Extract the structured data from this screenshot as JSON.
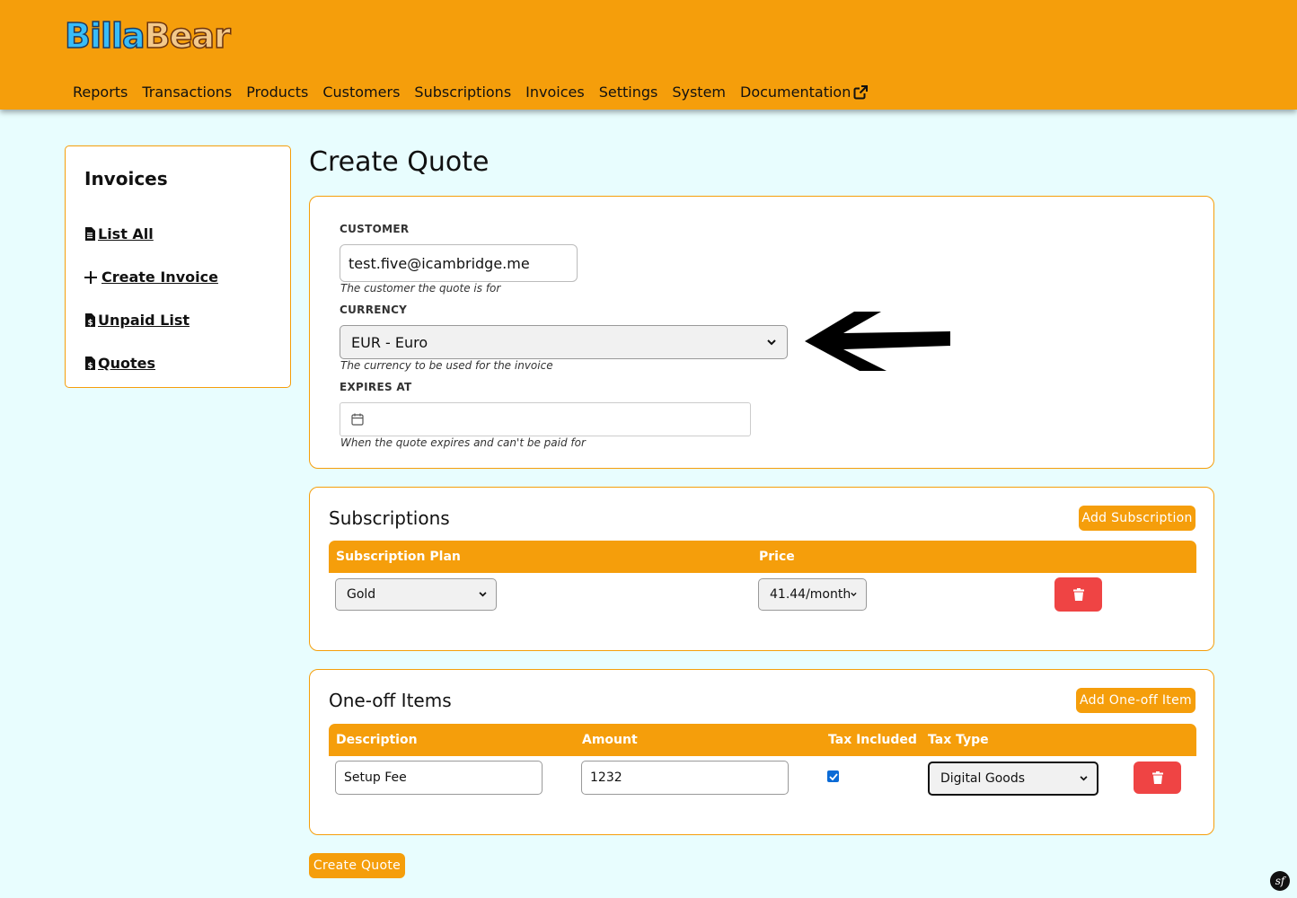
{
  "brand": {
    "part1": "Billa",
    "part2": "Bear"
  },
  "nav": {
    "reports": "Reports",
    "transactions": "Transactions",
    "products": "Products",
    "customers": "Customers",
    "subscriptions": "Subscriptions",
    "invoices": "Invoices",
    "settings": "Settings",
    "system": "System",
    "documentation": "Documentation"
  },
  "sidebar": {
    "title": "Invoices",
    "items": [
      {
        "label": "List All",
        "icon": "file-icon"
      },
      {
        "label": "Create Invoice",
        "icon": "plus-icon"
      },
      {
        "label": "Unpaid List",
        "icon": "file-invoice-dollar-icon"
      },
      {
        "label": "Quotes",
        "icon": "file-invoice-dollar-icon"
      }
    ]
  },
  "page": {
    "title": "Create Quote"
  },
  "form": {
    "customer_label": "CUSTOMER",
    "customer_value": "test.five@icambridge.me",
    "customer_help": "The customer the quote is for",
    "currency_label": "CURRENCY",
    "currency_value": "EUR - Euro",
    "currency_help": "The currency to be used for the invoice",
    "expires_label": "EXPIRES AT",
    "expires_value": "",
    "expires_help": "When the quote expires and can't be paid for"
  },
  "subscriptions": {
    "title": "Subscriptions",
    "add_label": "Add Subscription",
    "col_plan": "Subscription Plan",
    "col_price": "Price",
    "row": {
      "plan": "Gold",
      "price": "41.44/month"
    }
  },
  "oneoff": {
    "title": "One-off Items",
    "add_label": "Add One-off Item",
    "col_description": "Description",
    "col_amount": "Amount",
    "col_tax_included": "Tax Included",
    "col_tax_type": "Tax Type",
    "row": {
      "description": "Setup Fee",
      "amount": "1232",
      "tax_included": true,
      "tax_type": "Digital Goods"
    }
  },
  "submit_label": "Create Quote",
  "footer": {
    "symfony_badge": "sf"
  },
  "colors": {
    "accent": "#f59e0b",
    "danger": "#ef4444",
    "background": "#e8fdfe"
  }
}
